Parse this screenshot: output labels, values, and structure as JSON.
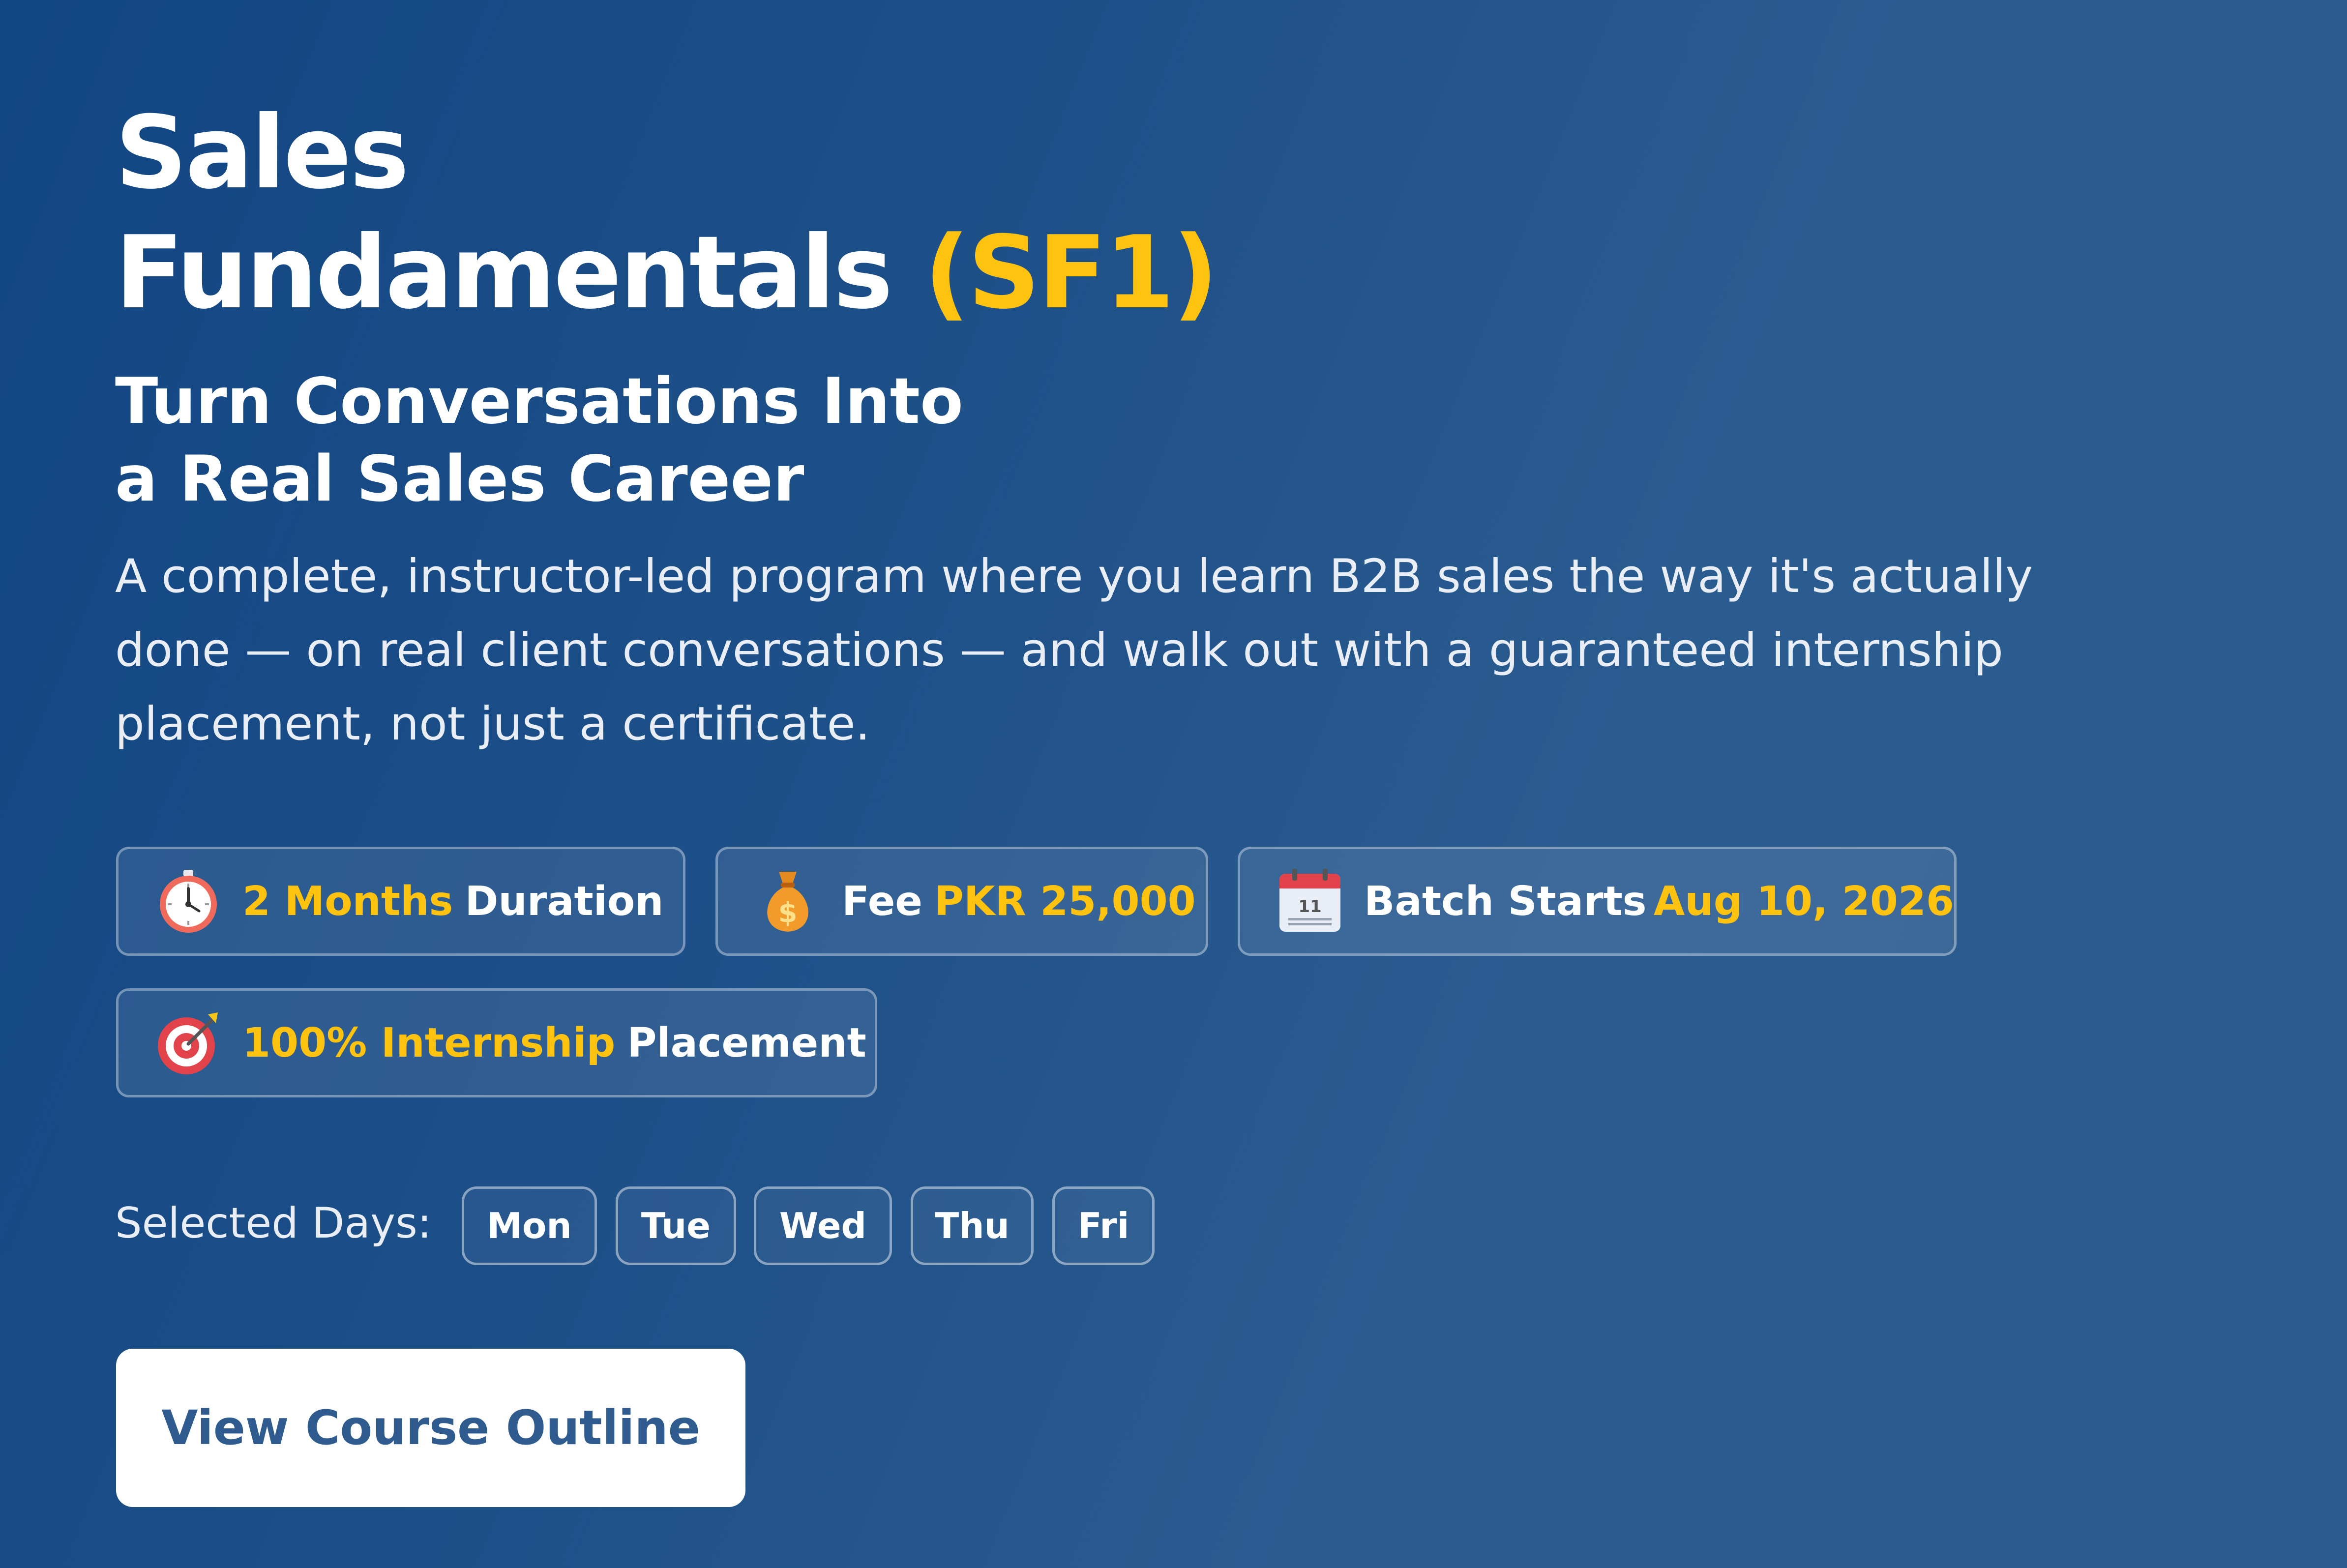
{
  "title": {
    "line1": "Sales",
    "line2": "Fundamentals",
    "code": "(SF1)"
  },
  "subtitle": {
    "line1": "Turn Conversations Into",
    "line2": "a Real Sales Career"
  },
  "description": {
    "line1": "A complete, instructor-led program where you learn B2B sales the way it's actually",
    "line2": "done — on real client conversations — and walk out with a guaranteed internship",
    "line3": "placement, not just a certificate."
  },
  "highlights": {
    "duration": {
      "icon": "stopwatch-icon",
      "highlight": "2 Months",
      "text": "Duration"
    },
    "fee": {
      "icon": "money-bag-icon",
      "text": "Fee",
      "highlight": "PKR 25,000"
    },
    "batch": {
      "icon": "calendar-icon",
      "text": "Batch Starts",
      "highlight": "Aug 10, 2026",
      "calendar_day": "11"
    },
    "placement": {
      "icon": "target-icon",
      "highlight": "100% Internship",
      "text": "Placement"
    }
  },
  "schedule": {
    "label": "Selected Days:",
    "days": [
      "Mon",
      "Tue",
      "Wed",
      "Thu",
      "Fri"
    ]
  },
  "cta": {
    "label": "View Course Outline"
  },
  "colors": {
    "accent": "#ffc20e",
    "background_start": "#124683",
    "background_end": "#2a5a8e",
    "button_text": "#2f5b8f"
  }
}
